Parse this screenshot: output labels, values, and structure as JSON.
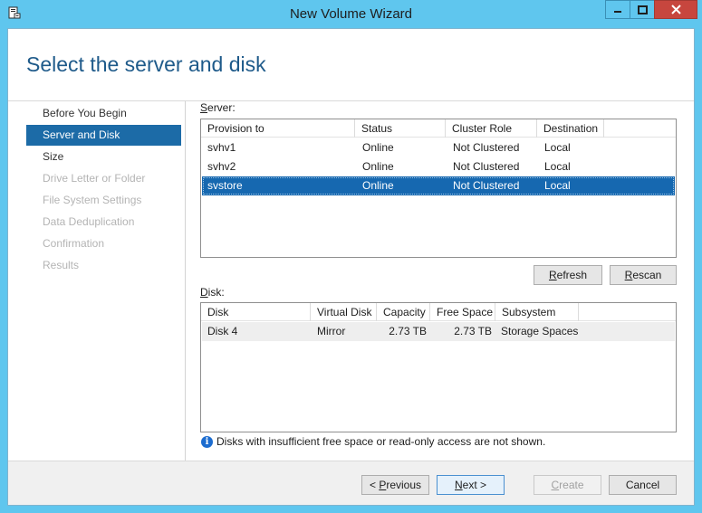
{
  "window": {
    "title": "New Volume Wizard",
    "controls": {
      "minimize": "–",
      "maximize": "□",
      "close": "✕"
    }
  },
  "header": {
    "title": "Select the server and disk"
  },
  "nav": {
    "items": [
      {
        "label": "Before You Begin",
        "state": "done"
      },
      {
        "label": "Server and Disk",
        "state": "active"
      },
      {
        "label": "Size",
        "state": "done"
      },
      {
        "label": "Drive Letter or Folder",
        "state": "pending"
      },
      {
        "label": "File System Settings",
        "state": "pending"
      },
      {
        "label": "Data Deduplication",
        "state": "pending"
      },
      {
        "label": "Confirmation",
        "state": "pending"
      },
      {
        "label": "Results",
        "state": "pending"
      }
    ]
  },
  "server": {
    "label_prefix": "S",
    "label_rest": "erver:",
    "columns": [
      "Provision to",
      "Status",
      "Cluster Role",
      "Destination"
    ],
    "rows": [
      {
        "provision_to": "svhv1",
        "status": "Online",
        "cluster_role": "Not Clustered",
        "destination": "Local"
      },
      {
        "provision_to": "svhv2",
        "status": "Online",
        "cluster_role": "Not Clustered",
        "destination": "Local"
      },
      {
        "provision_to": "svstore",
        "status": "Online",
        "cluster_role": "Not Clustered",
        "destination": "Local"
      }
    ],
    "selected_row": 2,
    "refresh_label": "Refresh",
    "refresh_key": "R",
    "refresh_rest": "efresh",
    "rescan_key": "R",
    "rescan_rest": "escan"
  },
  "disk": {
    "label_prefix": "D",
    "label_rest": "isk:",
    "columns": [
      "Disk",
      "Virtual Disk",
      "Capacity",
      "Free Space",
      "Subsystem"
    ],
    "rows": [
      {
        "disk": "Disk 4",
        "virtual_disk": "Mirror",
        "capacity": "2.73 TB",
        "free_space": "2.73 TB",
        "subsystem": "Storage Spaces"
      }
    ]
  },
  "info_message": "Disks with insufficient free space or read-only access are not shown.",
  "footer": {
    "previous_prefix": "< ",
    "previous_key": "P",
    "previous_rest": "revious",
    "next_key": "N",
    "next_rest": "ext >",
    "create_key": "C",
    "create_rest": "reate",
    "cancel_label": "Cancel"
  },
  "colors": {
    "title_bar": "#5fc6ee",
    "accent": "#1c6ba7",
    "selection": "#1668b0",
    "close_button": "#c7463e",
    "header_text": "#1e5a8a"
  }
}
